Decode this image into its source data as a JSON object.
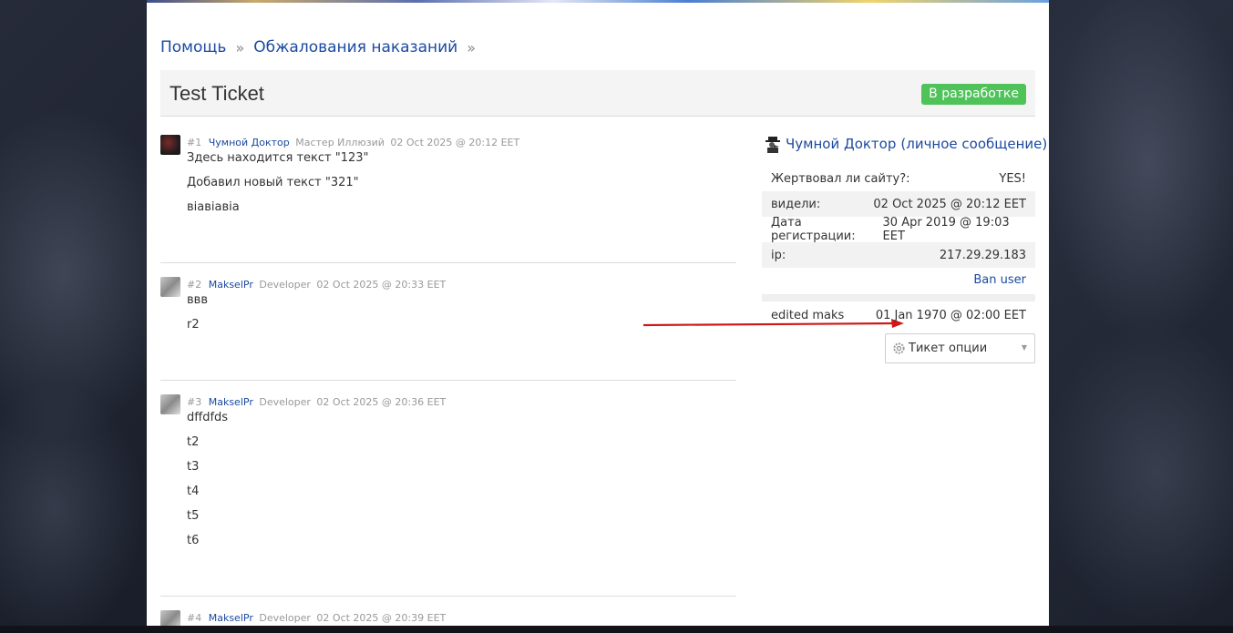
{
  "breadcrumb": {
    "items": [
      "Помощь",
      "Обжалования наказаний"
    ],
    "separator": "»"
  },
  "ticket": {
    "title": "Test Ticket",
    "status": "В разработке",
    "status_color": "#4fc25a"
  },
  "posts": [
    {
      "num": "#1",
      "author": "Чумной Доктор",
      "rank": "Мастер Иллюзий",
      "date": "02 Oct 2025 @ 20:12 EET",
      "lines": [
        "Здесь находится текст \"123\"",
        "Добавил новый текст \"321\"",
        "віавіавіа"
      ]
    },
    {
      "num": "#2",
      "author": "MakselPr",
      "rank": "Developer",
      "date": "02 Oct 2025 @ 20:33 EET",
      "lines": [
        "ввв",
        "r2"
      ]
    },
    {
      "num": "#3",
      "author": "MakselPr",
      "rank": "Developer",
      "date": "02 Oct 2025 @ 20:36 EET",
      "lines": [
        "dffdfds",
        "t2",
        "t3",
        "t4",
        "t5",
        "t6"
      ]
    },
    {
      "num": "#4",
      "author": "MakselPr",
      "rank": "Developer",
      "date": "02 Oct 2025 @ 20:39 EET",
      "lines": []
    }
  ],
  "sidebar": {
    "user_name": "Чумной Доктор",
    "pm_link": "личное сообщение",
    "rows": [
      {
        "label": "Жертвовал ли сайту?:",
        "value": "YES!"
      },
      {
        "label": "видели:",
        "value": "02 Oct 2025 @ 20:12 EET"
      },
      {
        "label": "Дата регистрации:",
        "value": "30 Apr 2019 @ 19:03 EET"
      },
      {
        "label": "ip:",
        "value": "217.29.29.183"
      }
    ],
    "ban_label": "Ban user",
    "edited": {
      "label": "edited maks",
      "value": "01 Jan 1970 @ 02:00 EET"
    },
    "options_label": "Тикет опции"
  },
  "colors": {
    "link": "#1c4aa0",
    "arrow": "#d01818"
  }
}
